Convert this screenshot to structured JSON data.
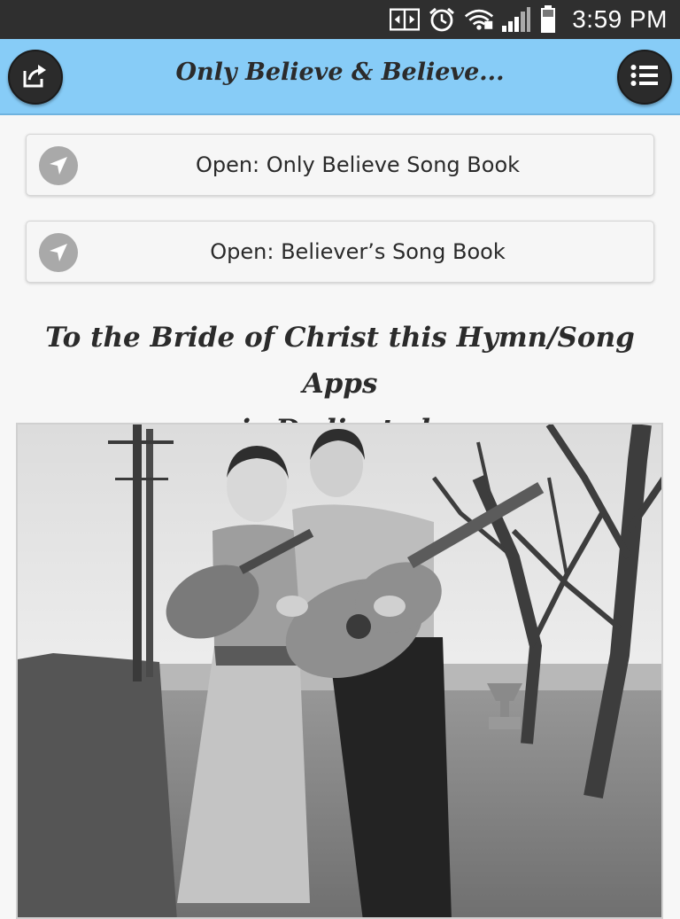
{
  "status_bar": {
    "time": "3:59 PM",
    "icons": [
      "screen-mirror-icon",
      "alarm-icon",
      "wifi-icon",
      "signal-icon",
      "battery-icon"
    ]
  },
  "header": {
    "title": "Only Believe & Believe...",
    "share_icon": "share-icon",
    "menu_icon": "list-menu-icon",
    "background": "#87ccf7"
  },
  "buttons": [
    {
      "label": "Open: Only Believe Song Book",
      "icon": "navigation-arrow-icon"
    },
    {
      "label": "Open: Believer’s Song Book",
      "icon": "navigation-arrow-icon"
    }
  ],
  "dedication": {
    "line1": "To the Bride of Christ this Hymn/Song Apps",
    "line2": "is Dedicated."
  },
  "photo": {
    "description_icon": "vintage-photo-couple-guitars"
  }
}
